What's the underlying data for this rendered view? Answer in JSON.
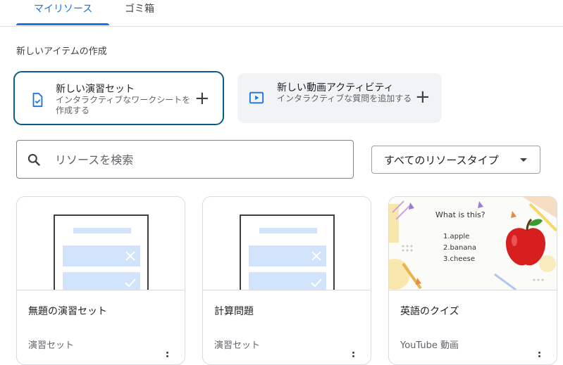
{
  "tabs": [
    {
      "label": "マイリソース",
      "active": true
    },
    {
      "label": "ゴミ箱",
      "active": false
    }
  ],
  "create_section": {
    "title": "新しいアイテムの作成",
    "cards": [
      {
        "title": "新しい演習セット",
        "subtitle": "インタラクティブなワークシートを作成する",
        "icon": "worksheet-icon",
        "action": "+"
      },
      {
        "title": "新しい動画アクティビティ",
        "subtitle": "インタラクティブな質問を追加する",
        "icon": "video-icon",
        "action": "+"
      }
    ]
  },
  "search": {
    "placeholder": "リソースを検索",
    "value": ""
  },
  "filter": {
    "label": "すべてのリソースタイプ"
  },
  "resources": [
    {
      "title": "無題の演習セット",
      "type": "演習セット"
    },
    {
      "title": "計算問題",
      "type": "演習セット"
    },
    {
      "title": "英語のクイズ",
      "type": "YouTube 動画",
      "thumbnail": {
        "heading": "What is this?",
        "options": [
          "1.apple",
          "2.banana",
          "3.cheese"
        ]
      }
    }
  ],
  "colors": {
    "accent": "#1a73e8",
    "selected_border": "#0b5c8a",
    "sheet_blue": "#d2e3fc"
  }
}
